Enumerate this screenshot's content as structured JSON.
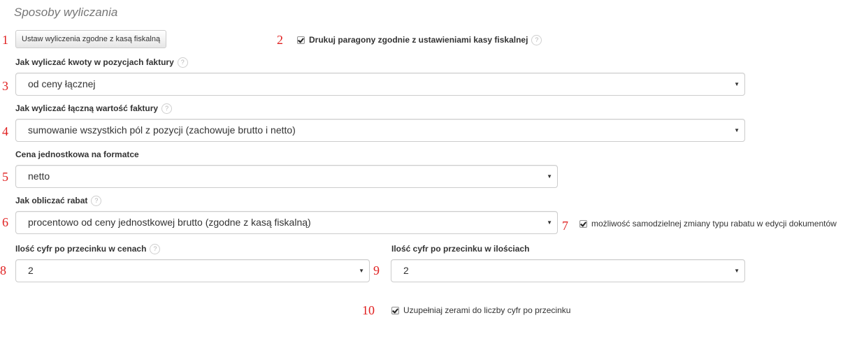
{
  "section": {
    "title": "Sposoby wyliczania"
  },
  "annotations": {
    "n1": "1",
    "n2": "2",
    "n3": "3",
    "n4": "4",
    "n5": "5",
    "n6": "6",
    "n7": "7",
    "n8": "8",
    "n9": "9",
    "n10": "10",
    "color": "#e02020"
  },
  "fiscal_button": {
    "label": "Ustaw wyliczenia zgodne z kasą fiskalną"
  },
  "print_receipts": {
    "label": "Drukuj paragony zgodnie z ustawieniami kasy fiskalnej",
    "checked": true,
    "help": "?"
  },
  "item_amounts": {
    "label": "Jak wyliczać kwoty w pozycjach faktury",
    "help": "?",
    "value": "od ceny łącznej"
  },
  "invoice_total": {
    "label": "Jak wyliczać łączną wartość faktury",
    "help": "?",
    "value": "sumowanie wszystkich pól z pozycji (zachowuje brutto i netto)"
  },
  "unit_price": {
    "label": "Cena jednostkowa na formatce",
    "value": "netto"
  },
  "discount": {
    "label": "Jak obliczać rabat",
    "help": "?",
    "value": "procentowo od ceny jednostkowej brutto (zgodne z kasą fiskalną)"
  },
  "discount_type_change": {
    "label": "możliwość samodzielnej zmiany typu rabatu w edycji dokumentów",
    "checked": true
  },
  "price_decimals": {
    "label": "Ilość cyfr po przecinku w cenach",
    "help": "?",
    "value": "2"
  },
  "quantity_decimals": {
    "label": "Ilość cyfr po przecinku w ilościach",
    "value": "2"
  },
  "pad_zeros": {
    "label": "Uzupełniaj zerami do liczby cyfr po przecinku",
    "checked": true
  },
  "caret": "▼"
}
